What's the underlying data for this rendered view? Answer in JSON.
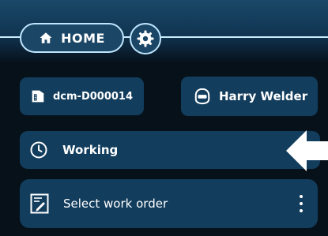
{
  "header": {
    "home_label": "HOME",
    "home_icon": "home-icon",
    "settings_icon": "gear-icon"
  },
  "device": {
    "id": "dcm-D000014",
    "icon": "device-icon"
  },
  "user": {
    "name": "Harry Welder",
    "icon": "welding-helmet-icon"
  },
  "status": {
    "label": "Working",
    "icon": "clock-icon"
  },
  "work_order": {
    "label": "Select work order",
    "icon": "edit-document-icon",
    "menu_icon": "more-vertical-icon"
  },
  "colors": {
    "background": "#07111a",
    "card": "#123d5d",
    "accent_border": "#bfe6ff",
    "indicator_arrow": "#ffffff"
  }
}
